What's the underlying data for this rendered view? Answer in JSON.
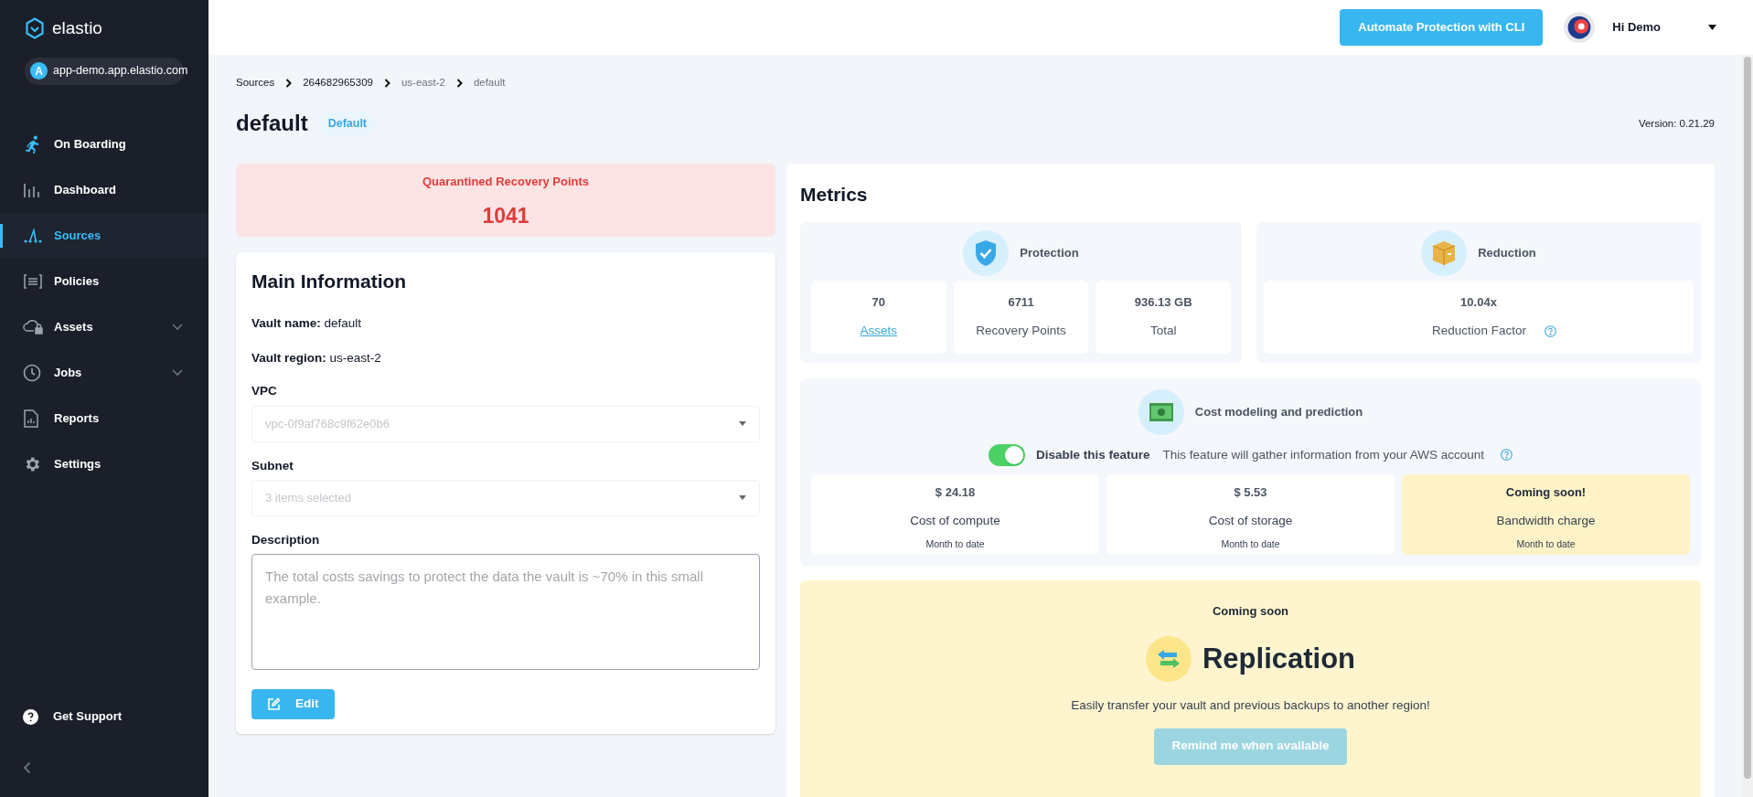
{
  "sidebar": {
    "brand": "elastio",
    "tenant": {
      "initial": "A",
      "host": "app-demo.app.elastio.com"
    },
    "items": [
      {
        "label": "On Boarding",
        "selected": false,
        "expandable": false
      },
      {
        "label": "Dashboard",
        "selected": false,
        "expandable": false
      },
      {
        "label": "Sources",
        "selected": true,
        "expandable": false
      },
      {
        "label": "Policies",
        "selected": false,
        "expandable": false
      },
      {
        "label": "Assets",
        "selected": false,
        "expandable": true
      },
      {
        "label": "Jobs",
        "selected": false,
        "expandable": true
      },
      {
        "label": "Reports",
        "selected": false,
        "expandable": false
      },
      {
        "label": "Settings",
        "selected": false,
        "expandable": false
      }
    ],
    "support": "Get Support"
  },
  "header": {
    "cli_button": "Automate Protection with CLI",
    "user": "Hi Demo"
  },
  "breadcrumbs": [
    "Sources",
    "264682965309",
    "us-east-2",
    "default"
  ],
  "page": {
    "title": "default",
    "badge": "Default",
    "version": "Version: 0.21.29"
  },
  "quarantine": {
    "label": "Quarantined Recovery Points",
    "value": "1041"
  },
  "main_info": {
    "title": "Main Information",
    "facts": [
      {
        "label": "Vault name:",
        "value": "default"
      },
      {
        "label": "Vault region:",
        "value": "us-east-2"
      }
    ],
    "fields": [
      {
        "kind": "select",
        "label": "VPC",
        "value": "vpc-0f9af768c9f62e0b6",
        "disabled": true
      },
      {
        "kind": "select",
        "label": "Subnet",
        "value": "3 items selected",
        "disabled": true
      },
      {
        "kind": "textarea",
        "label": "Description",
        "value": "The total costs savings to protect the data the vault is ~70% in this small example.",
        "disabled": true
      }
    ],
    "edit_button": "Edit"
  },
  "metrics": {
    "title": "Metrics",
    "protection": {
      "title": "Protection",
      "stats": [
        {
          "value": "70",
          "label": "Assets",
          "kind": "link"
        },
        {
          "value": "6711",
          "label": "Recovery Points",
          "kind": "text"
        },
        {
          "value": "936.13 GB",
          "label": "Total",
          "kind": "text"
        }
      ]
    },
    "reduction": {
      "title": "Reduction",
      "value": "10.04x",
      "label": "Reduction Factor"
    },
    "cost": {
      "title": "Cost modeling and prediction",
      "toggle": {
        "on": true,
        "label": "Disable this feature"
      },
      "note": "This feature will gather information from your AWS account",
      "cards": [
        {
          "kind": "value",
          "value": "$ 24.18",
          "label": "Cost of compute",
          "period": "Month to date"
        },
        {
          "kind": "value",
          "value": "$ 5.53",
          "label": "Cost of storage",
          "period": "Month to date"
        },
        {
          "kind": "coming_soon",
          "value": "Coming soon!",
          "label": "Bandwidth charge",
          "period": "Month to date"
        }
      ]
    },
    "replication": {
      "tag": "Coming soon",
      "title": "Replication",
      "text": "Easily transfer your vault and previous backups to another region!",
      "button": "Remind me when available",
      "button_disabled": true
    }
  }
}
